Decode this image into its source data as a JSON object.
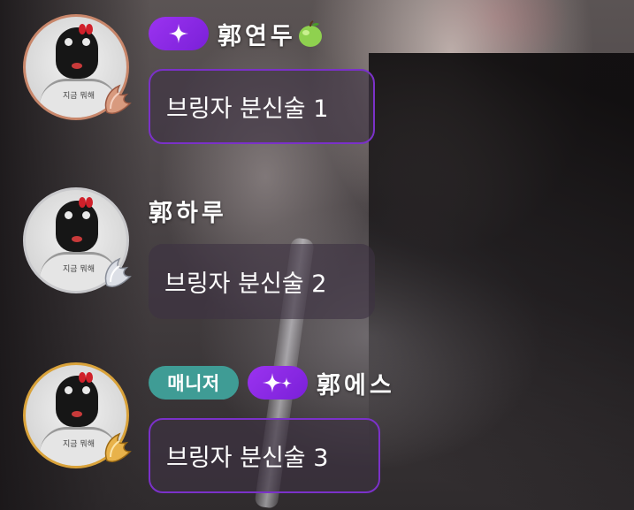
{
  "messages": [
    {
      "nickname": "郭연두",
      "badges": [
        "sparkle-badge"
      ],
      "name_icon": "green-apple-icon",
      "text": "브링자 분신술 1",
      "avatar_frame": "bronze",
      "bubble_style": "purple-border"
    },
    {
      "nickname": "郭하루",
      "badges": [],
      "text": "브링자 분신술 2",
      "avatar_frame": "silver",
      "bubble_style": "plain"
    },
    {
      "nickname": "郭에스",
      "badges": [
        "manager-badge",
        "double-sparkle-badge"
      ],
      "manager_label": "매니저",
      "text": "브링자 분신술 3",
      "avatar_frame": "gold",
      "bubble_style": "purple-border"
    }
  ],
  "avatar_caption": "지금 뭐해",
  "colors": {
    "sparkle_badge": "#8a2be2",
    "manager_badge": "#3f9c95",
    "bubble_border": "#7b31c9",
    "bronze_frame": "#c8866a",
    "silver_frame": "#c9c9cc",
    "gold_frame": "#d9a23a"
  }
}
